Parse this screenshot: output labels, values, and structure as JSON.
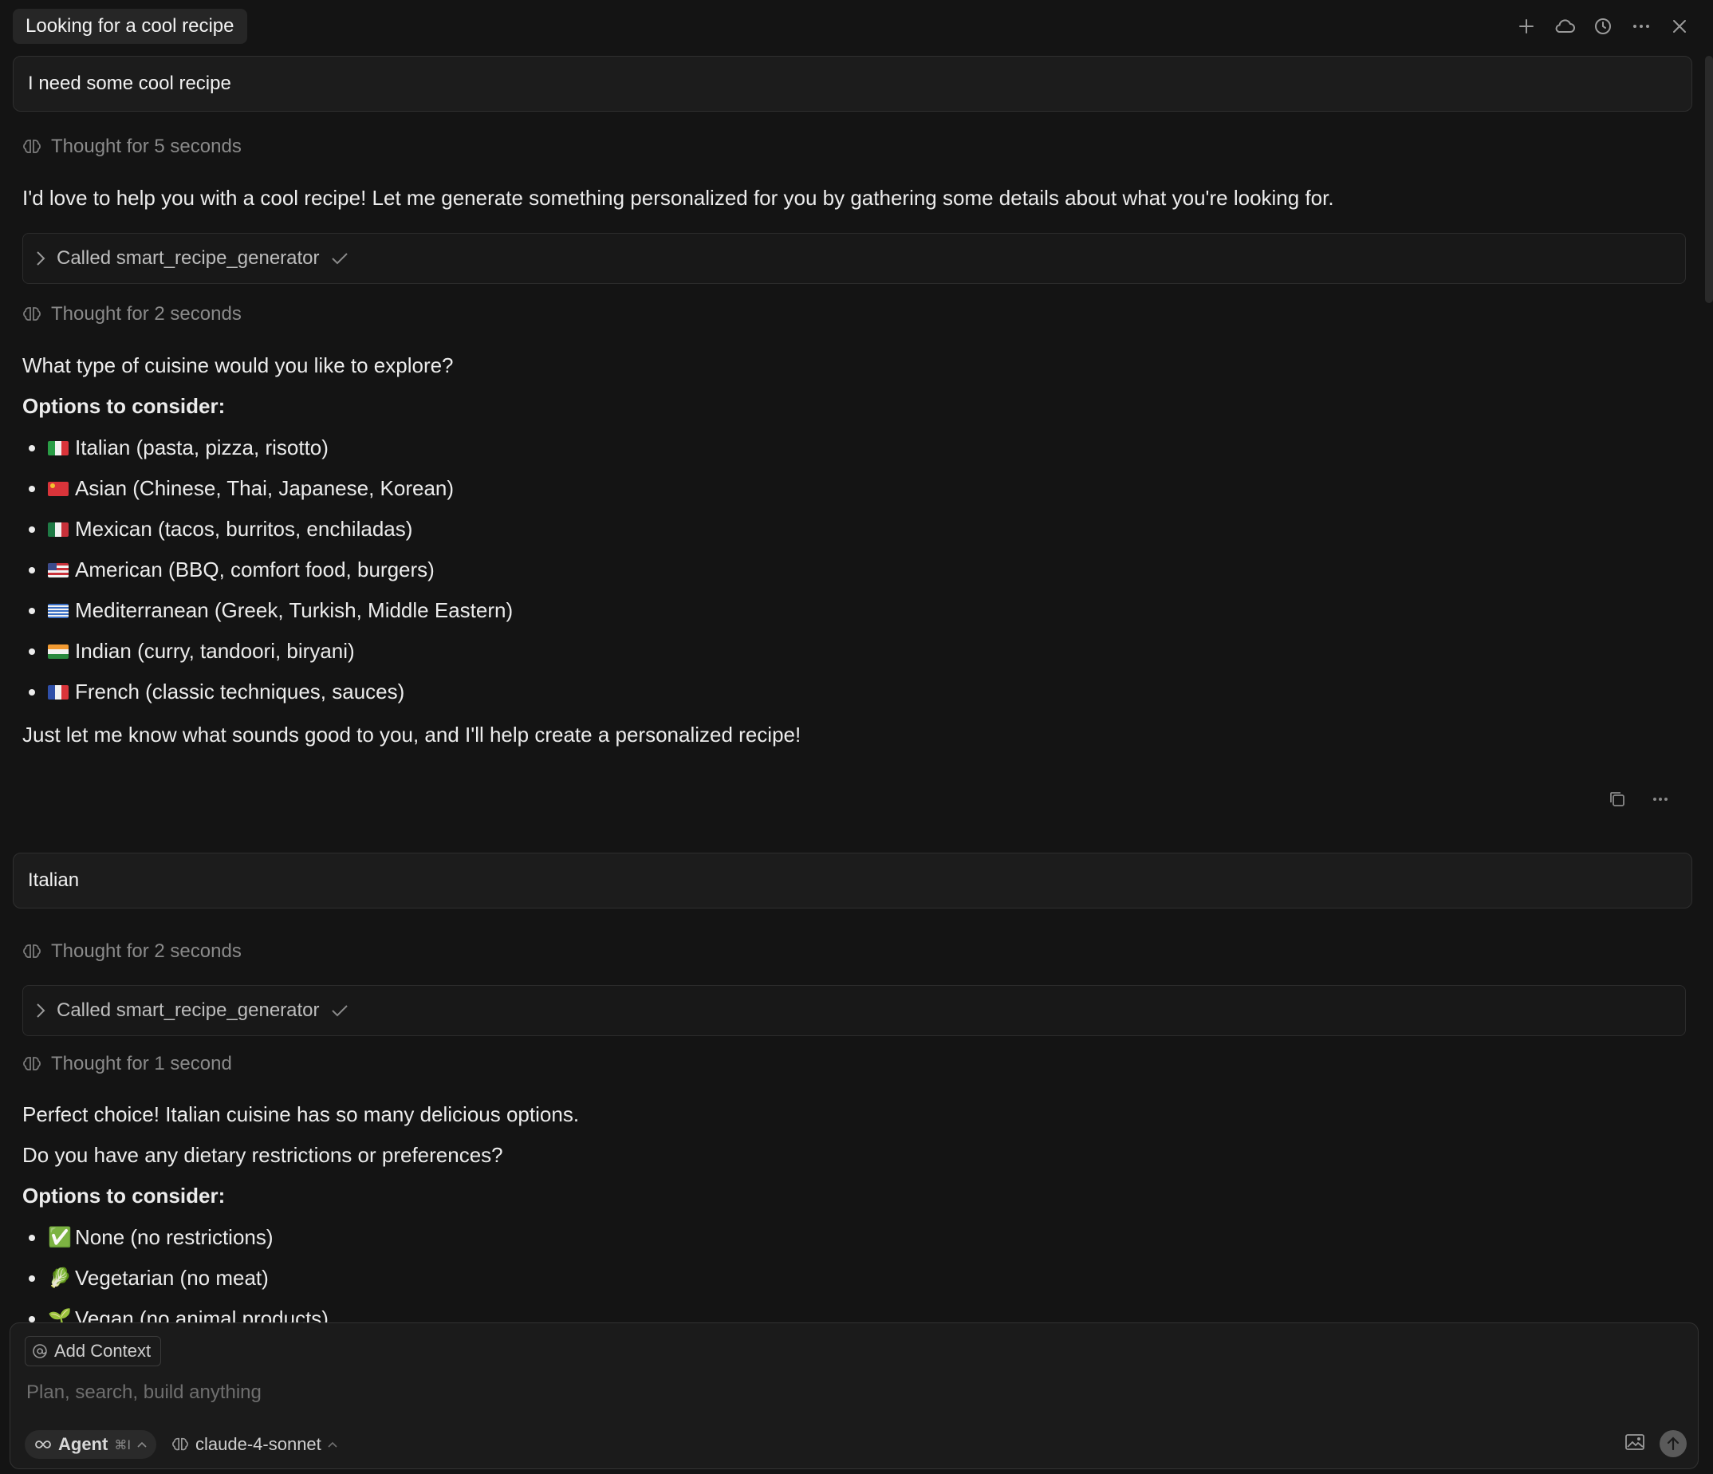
{
  "header": {
    "title": "Looking for a cool recipe"
  },
  "topbar_icons": [
    "plus-icon",
    "cloud-icon",
    "history-icon",
    "ellipsis-icon",
    "close-icon"
  ],
  "conversation": {
    "user_message_1": "I need some cool recipe",
    "thought_1": "Thought for 5 seconds",
    "assistant_intro": "I'd love to help you with a cool recipe! Let me generate something personalized for you by gathering some details about what you're looking for.",
    "tool_call_1": "Called smart_recipe_generator",
    "thought_2": "Thought for 2 seconds",
    "question_1": "What type of cuisine would you like to explore?",
    "options_heading_1": "Options to consider:",
    "cuisine_options": [
      "Italian (pasta, pizza, risotto)",
      "Asian (Chinese, Thai, Japanese, Korean)",
      "Mexican (tacos, burritos, enchiladas)",
      "American (BBQ, comfort food, burgers)",
      "Mediterranean (Greek, Turkish, Middle Eastern)",
      "Indian (curry, tandoori, biryani)",
      "French (classic techniques, sauces)"
    ],
    "closing_1": "Just let me know what sounds good to you, and I'll help create a personalized recipe!",
    "user_message_2": "Italian",
    "thought_3": "Thought for 2 seconds",
    "tool_call_2": "Called smart_recipe_generator",
    "thought_4": "Thought for 1 second",
    "assistant_2_line_1": "Perfect choice! Italian cuisine has so many delicious options.",
    "question_2": "Do you have any dietary restrictions or preferences?",
    "options_heading_2": "Options to consider:",
    "dietary_options": [
      {
        "emoji": "✅",
        "label": "None (no restrictions)"
      },
      {
        "emoji": "🥬",
        "label": "Vegetarian (no meat)"
      },
      {
        "emoji": "🌱",
        "label": "Vegan (no animal products)"
      }
    ]
  },
  "composer": {
    "add_context_label": "Add Context",
    "placeholder": "Plan, search, build anything",
    "mode_label": "Agent",
    "mode_shortcut": "⌘I",
    "model_label": "claude-4-sonnet"
  },
  "colors": {
    "background": "#141414",
    "bubble": "#1c1c1c",
    "muted_text": "#8a8a8a",
    "text": "#ececec"
  }
}
